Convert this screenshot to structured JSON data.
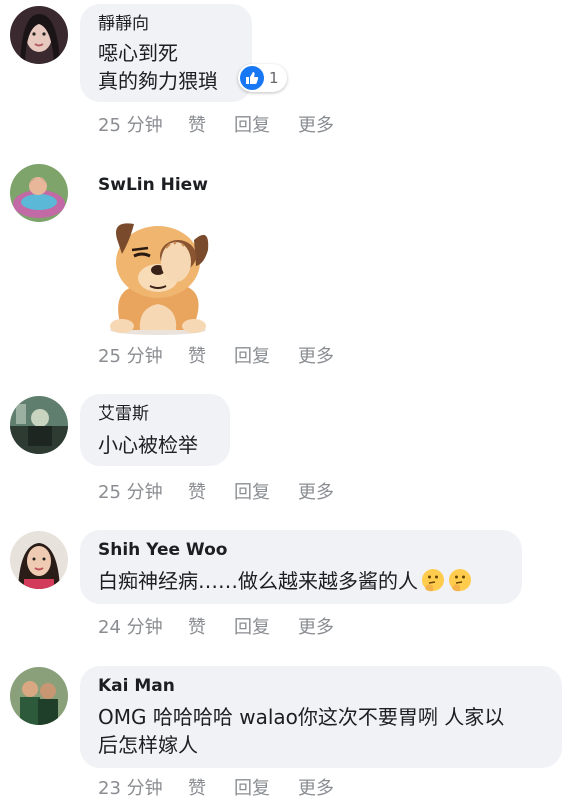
{
  "comments": [
    {
      "author": "靜靜向",
      "lines": [
        "噁心到死",
        "真的夠力猥瑣"
      ],
      "reaction_count": "1",
      "time": "25 分钟",
      "like": "赞",
      "reply": "回复",
      "more": "更多"
    },
    {
      "author": "SwLin Hiew",
      "sticker": "facepalm-dog-sticker",
      "time": "25 分钟",
      "like": "赞",
      "reply": "回复",
      "more": "更多"
    },
    {
      "author": "艾雷斯",
      "lines": [
        "小心被检举"
      ],
      "time": "25 分钟",
      "like": "赞",
      "reply": "回复",
      "more": "更多"
    },
    {
      "author": "Shih Yee Woo",
      "lines": [
        "白痴神经病……做么越来越多酱的人"
      ],
      "emojis": [
        "thinking-face-emoji",
        "thinking-face-emoji"
      ],
      "time": "24 分钟",
      "like": "赞",
      "reply": "回复",
      "more": "更多"
    },
    {
      "author": "Kai Man",
      "lines": [
        "OMG 哈哈哈哈 walao你这次不要胃咧 人家以",
        "后怎样嫁人"
      ],
      "time": "23 分钟",
      "like": "赞",
      "reply": "回复",
      "more": "更多"
    }
  ],
  "colors": {
    "bubble": "#f0f2f5",
    "meta": "#8a8d91",
    "like_blue": "#1877f2"
  }
}
